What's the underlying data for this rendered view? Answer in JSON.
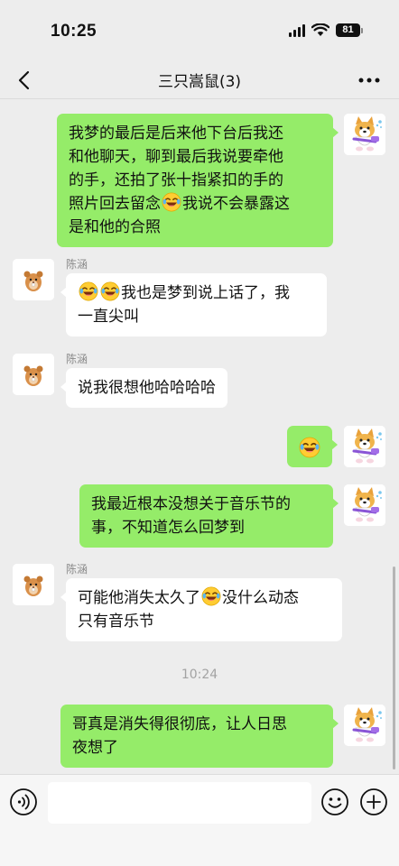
{
  "status": {
    "time": "10:25",
    "battery": "81"
  },
  "nav": {
    "title": "三只嵩鼠(3)"
  },
  "messages": [
    {
      "lines": [
        "我梦的最后是后来他下台后我还",
        "和他聊天，聊到最后我说要牵他",
        "的手，还拍了张十指紧扣的手的"
      ],
      "line4a": "照片回去留念",
      "line4b": "我说不会暴露这",
      "line5": "是和他的合照"
    },
    {
      "sender": "陈涵",
      "line1b": "我也是梦到说上话了，我",
      "line2": "一直尖叫"
    },
    {
      "sender": "陈涵",
      "text": "说我很想他哈哈哈哈"
    },
    {
      "emoji": "laugh-cry-emoji"
    },
    {
      "lines": [
        "我最近根本没想关于音乐节的",
        "事，不知道怎么回梦到"
      ]
    },
    {
      "sender": "陈涵",
      "line1a": "可能他消失太久了",
      "line1b": "没什么动态",
      "line2": "只有音乐节"
    },
    {
      "lines": [
        "哥真是消失得很彻底，让人日思",
        "夜想了"
      ]
    }
  ],
  "timestamp": "10:24",
  "input": {
    "placeholder": ""
  },
  "colors": {
    "outgoing_bubble": "#95ec69",
    "incoming_bubble": "#ffffff",
    "background": "#ededed"
  }
}
